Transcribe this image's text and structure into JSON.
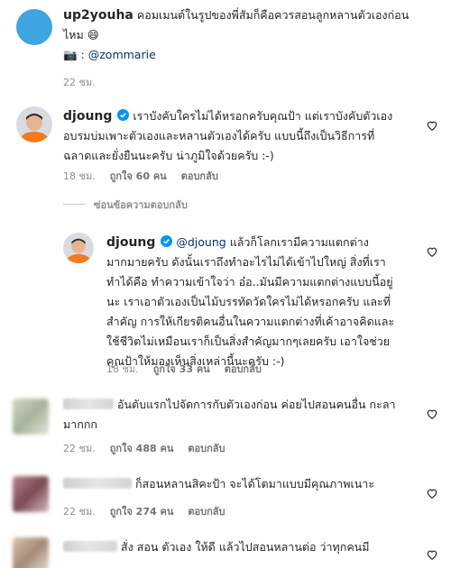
{
  "comments": [
    {
      "user": "up2youha",
      "text_line1": "คอมเมนต์ในรูปของพี่สัมก็คือควรสอนลูกหลานตัวเองก่อน",
      "text_line2": "ไหม 😄",
      "credit_icon": "camera-emoji",
      "credit_emoji": "📷",
      "credit_text": ": @zommarie",
      "time": "22 ชม.",
      "avatar_color": "#3da5e0"
    },
    {
      "user": "djoung",
      "verified": true,
      "text_line1": "เราบังคับใครไม่ได้หรอกครับคุณป้า แต่เราบังคับตัวเอง",
      "text_line2": "อบรมบ่มเพาะตัวเองและหลานตัวเองได้ครับ แบบนี้ถึงเป็นวิธีการที่",
      "text_line3": "ฉลาดและยั่งยืนนะครับ น่าภูมิใจด้วยครับ :-)",
      "time": "18 ชม.",
      "likes": "ถูกใจ 60 คน",
      "reply": "ตอบกลับ"
    }
  ],
  "hide_replies": "ซ่อนข้อความตอบกลับ",
  "reply1": {
    "user": "djoung",
    "mention": "@djoung",
    "text_line1_rest": " แล้วก็โลกเรามีความแตกต่าง",
    "text_line2": "มากมายครับ ดังนั้นเราถึงทำอะไรไม่ได้เข้าไปใหญ่ สิ่งที่เรา",
    "text_line3": "ทำได้คือ ทำความเข้าใจว่า อ๋อ..มันมีความแตกต่างแบบนี้อยู่",
    "text_line4": "นะ เราเอาตัวเองเป็นไม้บรรทัดวัดใครไม่ได้หรอกครับ และที่",
    "text_line5": "สำคัญ การให้เกียรติคนอื่นในความแตกต่างที่เค้าอาจคิดและ",
    "text_line6": "ใช้ชีวิตไม่เหมือนเราก็เป็นสิ่งสำคัญมากๆเลยครับ เอาใจช่วย",
    "text_line7": "คุณป้าให้มองเห็นสิ่งเหล่านี้นะครับ :-)",
    "time": "18 ชม.",
    "likes": "ถูกใจ 33 คน",
    "reply": "ตอบกลับ"
  },
  "others": [
    {
      "text_line1": "อันดับแรกไปจัดการกับตัวเองก่อน ค่อยไปสอนคนอื่น กะลา",
      "text_line2": "มากกก",
      "time": "22 ชม.",
      "likes": "ถูกใจ 488 คน",
      "reply": "ตอบกลับ"
    },
    {
      "text_line1": "ก็สอนหลานสิคะป้า จะได้โตมาแบบมีคุณภาพเนาะ",
      "time": "22 ชม.",
      "likes": "ถูกใจ 274 คน",
      "reply": "ตอบกลับ"
    },
    {
      "text_line1": "สั่ง สอน ตัวเอง ให้ดี แล้วไปสอนหลานต่อ ว่าทุกคนมี"
    }
  ]
}
